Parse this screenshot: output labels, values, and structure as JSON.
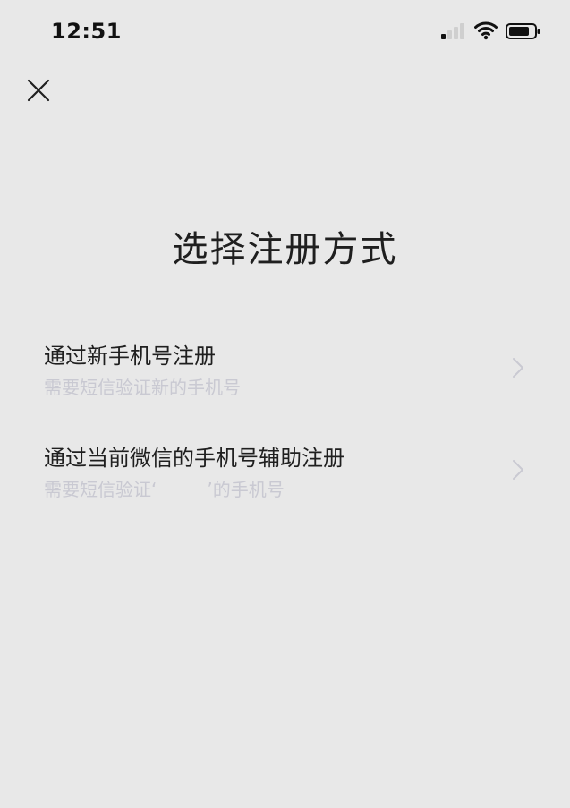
{
  "status_bar": {
    "time": "12:51",
    "icons": [
      "signal-icon",
      "wifi-icon",
      "battery-icon"
    ]
  },
  "header": {
    "close_icon": "close-icon"
  },
  "main": {
    "title": "选择注册方式",
    "options": [
      {
        "title": "通过新手机号注册",
        "desc": "需要短信验证新的手机号"
      },
      {
        "title": "通过当前微信的手机号辅助注册",
        "desc_prefix": "需要短信验证‘",
        "desc_suffix": "’的手机号"
      }
    ]
  },
  "colors": {
    "background": "#E8E8E8",
    "title_text": "#1F1F1F",
    "desc_text": "#C9C9D2",
    "chevron": "#C9C9D2"
  }
}
